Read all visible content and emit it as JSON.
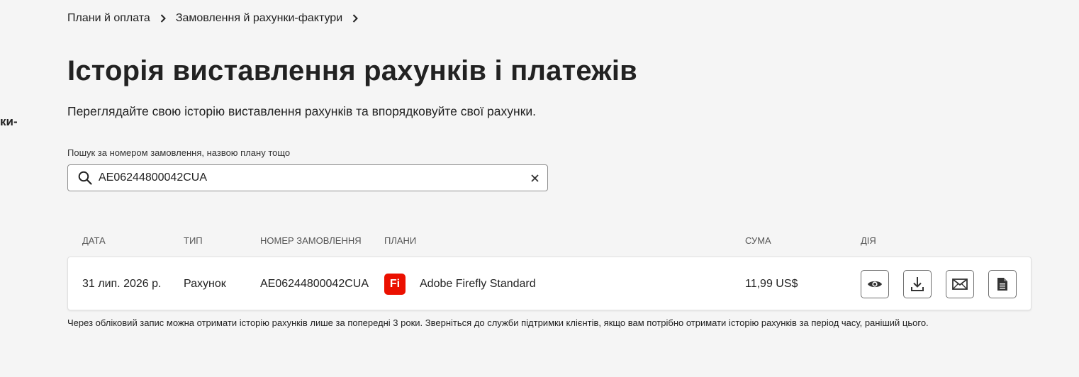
{
  "side_fragment": "ки-",
  "breadcrumb": {
    "items": [
      "Плани й оплата",
      "Замовлення й рахунки-фактури"
    ]
  },
  "page": {
    "title": "Історія виставлення рахунків і платежів",
    "subtitle": "Переглядайте свою історію виставлення рахунків та впорядковуйте свої рахунки."
  },
  "search": {
    "label": "Пошук за номером замовлення, назвою плану тощо",
    "value": "AE06244800042CUA"
  },
  "table": {
    "headers": {
      "date": "ДАТА",
      "type": "ТИП",
      "order": "НОМЕР ЗАМОВЛЕННЯ",
      "plans": "ПЛАНИ",
      "amount": "СУМА",
      "action": "ДІЯ"
    },
    "rows": [
      {
        "date": "31 лип. 2026 р.",
        "type": "Рахунок",
        "order": "AE06244800042CUA",
        "plan_logo": "Fi",
        "plan": "Adobe Firefly Standard",
        "amount": "11,99 US$"
      }
    ],
    "actions": [
      "eye-icon",
      "download-icon",
      "mail-icon",
      "document-icon"
    ]
  },
  "footnote": "Через обліковий запис можна отримати історію рахунків лише за попередні 3 роки. Зверніться до служби підтримки клієнтів, якщо вам потрібно отримати історію рахунків за період часу, раніший цього.",
  "colors": {
    "background": "#f5f5f5",
    "firefly_brand": "#eb1000",
    "text": "#222222"
  }
}
